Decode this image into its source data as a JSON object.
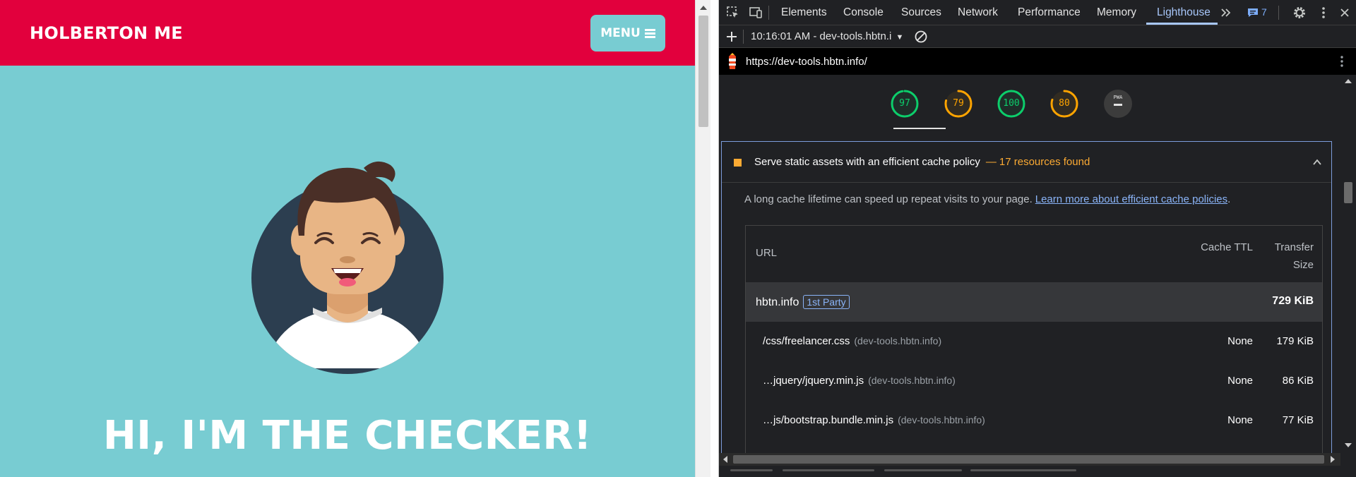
{
  "site": {
    "brand": "HOLBERTON ME",
    "menu_label": "MENU",
    "hero_title": "HI, I'M THE CHECKER!",
    "colors": {
      "nav": "#e2003d",
      "body": "#78ccd2"
    }
  },
  "devtools": {
    "tabs": [
      "Elements",
      "Console",
      "Sources",
      "Network",
      "Performance",
      "Memory",
      "Lighthouse"
    ],
    "active_tab": "Lighthouse",
    "issues_count": "7",
    "report_select": "10:16:01 AM - dev-tools.hbtn.i",
    "url": "https://dev-tools.hbtn.info/",
    "scores": [
      {
        "value": "97",
        "status": "pass",
        "color": "#0cce6b"
      },
      {
        "value": "79",
        "status": "average",
        "color": "#ffa400"
      },
      {
        "value": "100",
        "status": "pass",
        "color": "#0cce6b"
      },
      {
        "value": "80",
        "status": "average",
        "color": "#ffa400"
      },
      {
        "value": "PWA",
        "status": "na",
        "color": "#9aa0a6"
      }
    ],
    "audit": {
      "title": "Serve static assets with an efficient cache policy",
      "separator": "—",
      "count_text": "17 resources found",
      "description": "A long cache lifetime can speed up repeat visits to your page.",
      "link": "Learn more about efficient cache policies",
      "table": {
        "headers": {
          "url": "URL",
          "cache_ttl": "Cache TTL",
          "transfer_size": "Transfer Size"
        },
        "group": {
          "host": "hbtn.info",
          "badge": "1st Party",
          "size": "729 KiB"
        },
        "rows": [
          {
            "url": "/css/freelancer.css",
            "host": "(dev-tools.hbtn.info)",
            "ttl": "None",
            "size": "179 KiB"
          },
          {
            "url": "…jquery/jquery.min.js",
            "host": "(dev-tools.hbtn.info)",
            "ttl": "None",
            "size": "86 KiB"
          },
          {
            "url": "…js/bootstrap.bundle.min.js",
            "host": "(dev-tools.hbtn.info)",
            "ttl": "None",
            "size": "77 KiB"
          }
        ]
      }
    }
  }
}
